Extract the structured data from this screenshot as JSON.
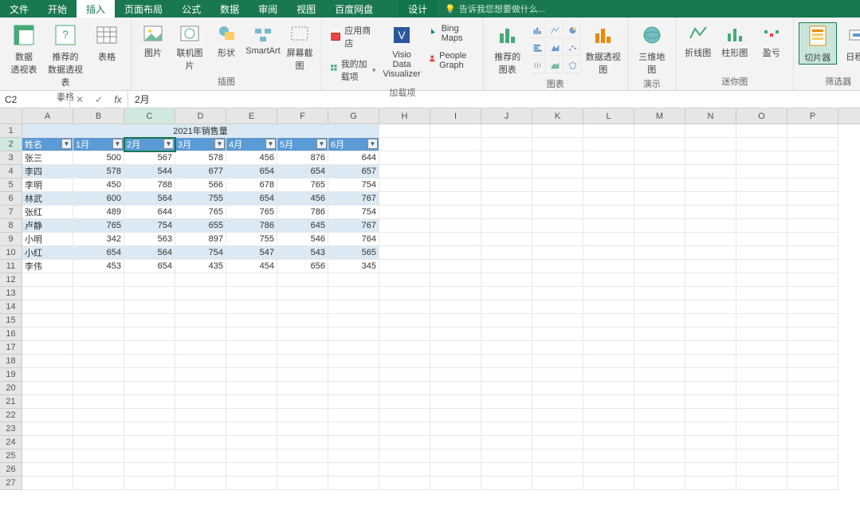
{
  "menu": {
    "tabs": [
      "文件",
      "开始",
      "插入",
      "页面布局",
      "公式",
      "数据",
      "审阅",
      "视图",
      "百度网盘"
    ],
    "context_tab": "设计",
    "active_index": 2,
    "tell_me": "告诉我您想要做什么..."
  },
  "ribbon": {
    "group_tables": {
      "label": "表格",
      "pivot": "数据\n透视表",
      "rec_pivot": "推荐的\n数据透视表",
      "table": "表格"
    },
    "group_illust": {
      "label": "插图",
      "picture": "图片",
      "online_pic": "联机图片",
      "shapes": "形状",
      "smartart": "SmartArt",
      "screenshot": "屏幕截图"
    },
    "group_addins": {
      "label": "加载项",
      "store": "应用商店",
      "myaddins": "我的加载项",
      "visio": "Visio Data\nVisualizer",
      "bing": "Bing Maps",
      "people": "People Graph"
    },
    "group_charts": {
      "label": "图表",
      "rec_chart": "推荐的\n图表",
      "pivot_chart": "数据透视图",
      "map3d": "三维地\n图",
      "map3d_sub": "演示"
    },
    "group_spark": {
      "label": "迷你图",
      "line": "折线图",
      "col": "柱形图",
      "winloss": "盈亏"
    },
    "group_filter": {
      "label": "筛选器",
      "slicer": "切片器",
      "timeline": "日程表"
    }
  },
  "formula_bar": {
    "name_box": "C2",
    "value": "2月"
  },
  "columns": [
    "A",
    "B",
    "C",
    "D",
    "E",
    "F",
    "G",
    "H",
    "I",
    "J",
    "K",
    "L",
    "M",
    "N",
    "O",
    "P"
  ],
  "selected_col_index": 2,
  "selected_row_index": 1,
  "table": {
    "title": "2021年销售量",
    "headers": [
      "姓名",
      "1月",
      "2月",
      "3月",
      "4月",
      "5月",
      "6月"
    ],
    "rows": [
      [
        "张三",
        500,
        567,
        578,
        456,
        876,
        644
      ],
      [
        "李四",
        578,
        544,
        677,
        654,
        654,
        657
      ],
      [
        "李明",
        450,
        788,
        566,
        678,
        765,
        754
      ],
      [
        "林武",
        600,
        564,
        755,
        654,
        456,
        767
      ],
      [
        "张红",
        489,
        644,
        765,
        765,
        786,
        754
      ],
      [
        "卢静",
        765,
        754,
        655,
        786,
        645,
        767
      ],
      [
        "小明",
        342,
        563,
        897,
        755,
        546,
        764
      ],
      [
        "小红",
        654,
        564,
        754,
        547,
        543,
        565
      ],
      [
        "李伟",
        453,
        654,
        435,
        454,
        656,
        345
      ]
    ]
  },
  "empty_rows": 16
}
